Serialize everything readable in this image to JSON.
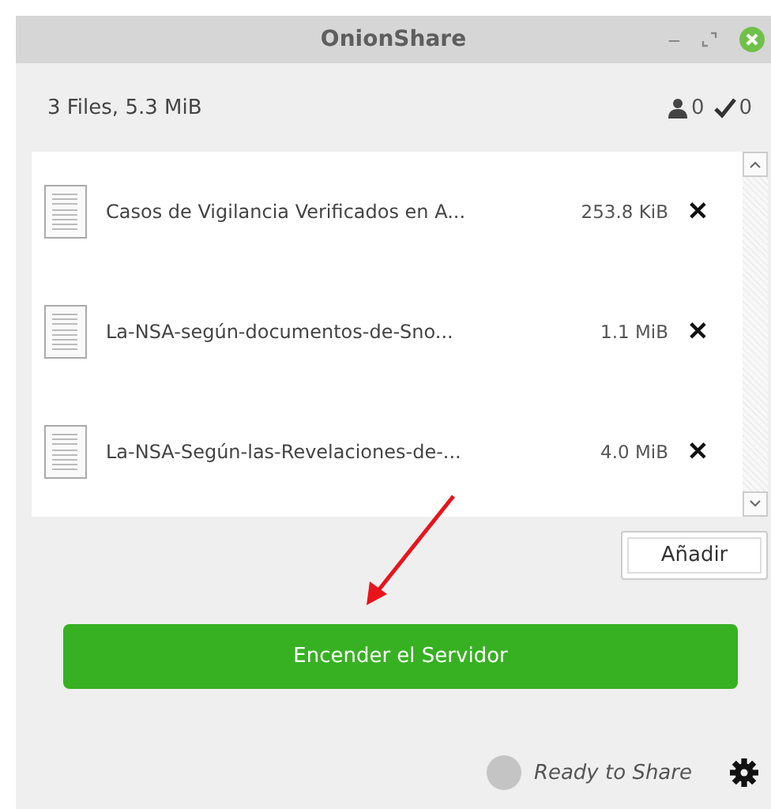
{
  "window": {
    "title": "OnionShare",
    "buttons": [
      "–"
    ]
  },
  "summary": "3 Files, 5.3 MiB",
  "counters": [
    {
      "kind": "person",
      "value": "0"
    },
    {
      "kind": "check",
      "value": "0"
    }
  ],
  "files": [
    {
      "name": "Casos de Vigilancia Verificados en A...",
      "size": "253.8 KiB",
      "remove": "✕"
    },
    {
      "name": "La-NSA-según-documentos-de-Sno...",
      "size": "1.1 MiB",
      "remove": "✕"
    },
    {
      "name": "La-NSA-Según-las-Revelaciones-de-...",
      "size": "4.0 MiB",
      "remove": "✕"
    }
  ],
  "add_button": "Añadir",
  "start_button": "Encender el Servidor",
  "status": {
    "text": "Ready to Share",
    "color": "#c4c4c4"
  }
}
